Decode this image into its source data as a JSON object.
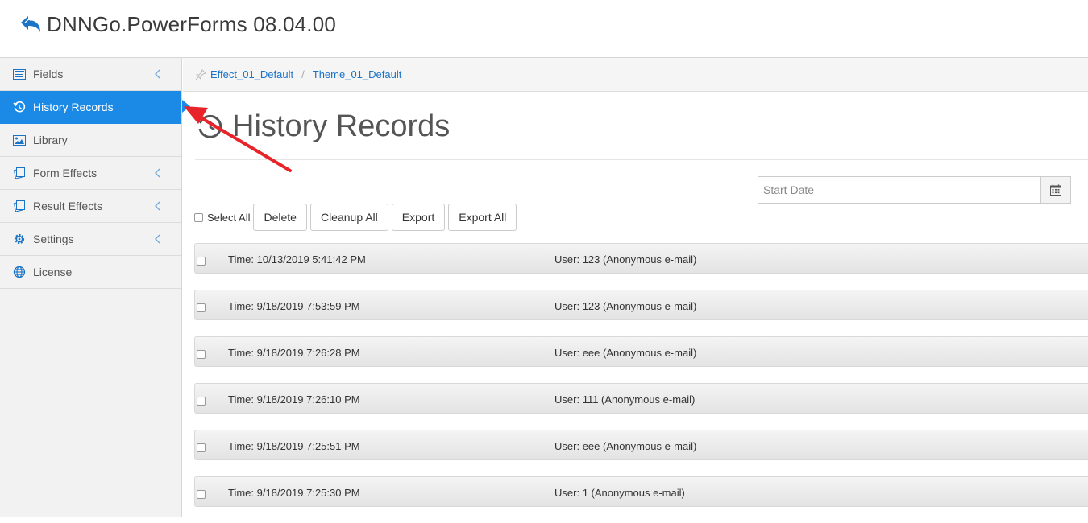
{
  "app": {
    "title": "DNNGo.PowerForms 08.04.00"
  },
  "sidebar": {
    "items": [
      {
        "label": "Fields",
        "icon": "list-icon",
        "has_chevron": true,
        "active": false
      },
      {
        "label": "History Records",
        "icon": "history-icon",
        "has_chevron": false,
        "active": true
      },
      {
        "label": "Library",
        "icon": "image-icon",
        "has_chevron": false,
        "active": false
      },
      {
        "label": "Form Effects",
        "icon": "cards-icon",
        "has_chevron": true,
        "active": false
      },
      {
        "label": "Result Effects",
        "icon": "cards-icon",
        "has_chevron": true,
        "active": false
      },
      {
        "label": "Settings",
        "icon": "gear-icon",
        "has_chevron": true,
        "active": false
      },
      {
        "label": "License",
        "icon": "globe-icon",
        "has_chevron": false,
        "active": false
      }
    ]
  },
  "breadcrumb": {
    "items": [
      "Effect_01_Default",
      "Theme_01_Default"
    ],
    "separator": "/"
  },
  "page": {
    "title": "History Records"
  },
  "filter": {
    "date_placeholder": "Start Date"
  },
  "toolbar": {
    "select_all_label": "Select All",
    "delete_label": "Delete",
    "cleanup_all_label": "Cleanup All",
    "export_label": "Export",
    "export_all_label": "Export All"
  },
  "records": [
    {
      "time_label": "Time:",
      "time": "10/13/2019 5:41:42 PM",
      "user_label": "User:",
      "user": "123 (Anonymous e-mail)"
    },
    {
      "time_label": "Time:",
      "time": "9/18/2019 7:53:59 PM",
      "user_label": "User:",
      "user": "123 (Anonymous e-mail)"
    },
    {
      "time_label": "Time:",
      "time": "9/18/2019 7:26:28 PM",
      "user_label": "User:",
      "user": "eee (Anonymous e-mail)"
    },
    {
      "time_label": "Time:",
      "time": "9/18/2019 7:26:10 PM",
      "user_label": "User:",
      "user": "111 (Anonymous e-mail)"
    },
    {
      "time_label": "Time:",
      "time": "9/18/2019 7:25:51 PM",
      "user_label": "User:",
      "user": "eee (Anonymous e-mail)"
    },
    {
      "time_label": "Time:",
      "time": "9/18/2019 7:25:30 PM",
      "user_label": "User:",
      "user": "1 (Anonymous e-mail)"
    }
  ],
  "colors": {
    "accent": "#1a8ae6",
    "link": "#1a73c7",
    "annotation": "#e8242a"
  }
}
